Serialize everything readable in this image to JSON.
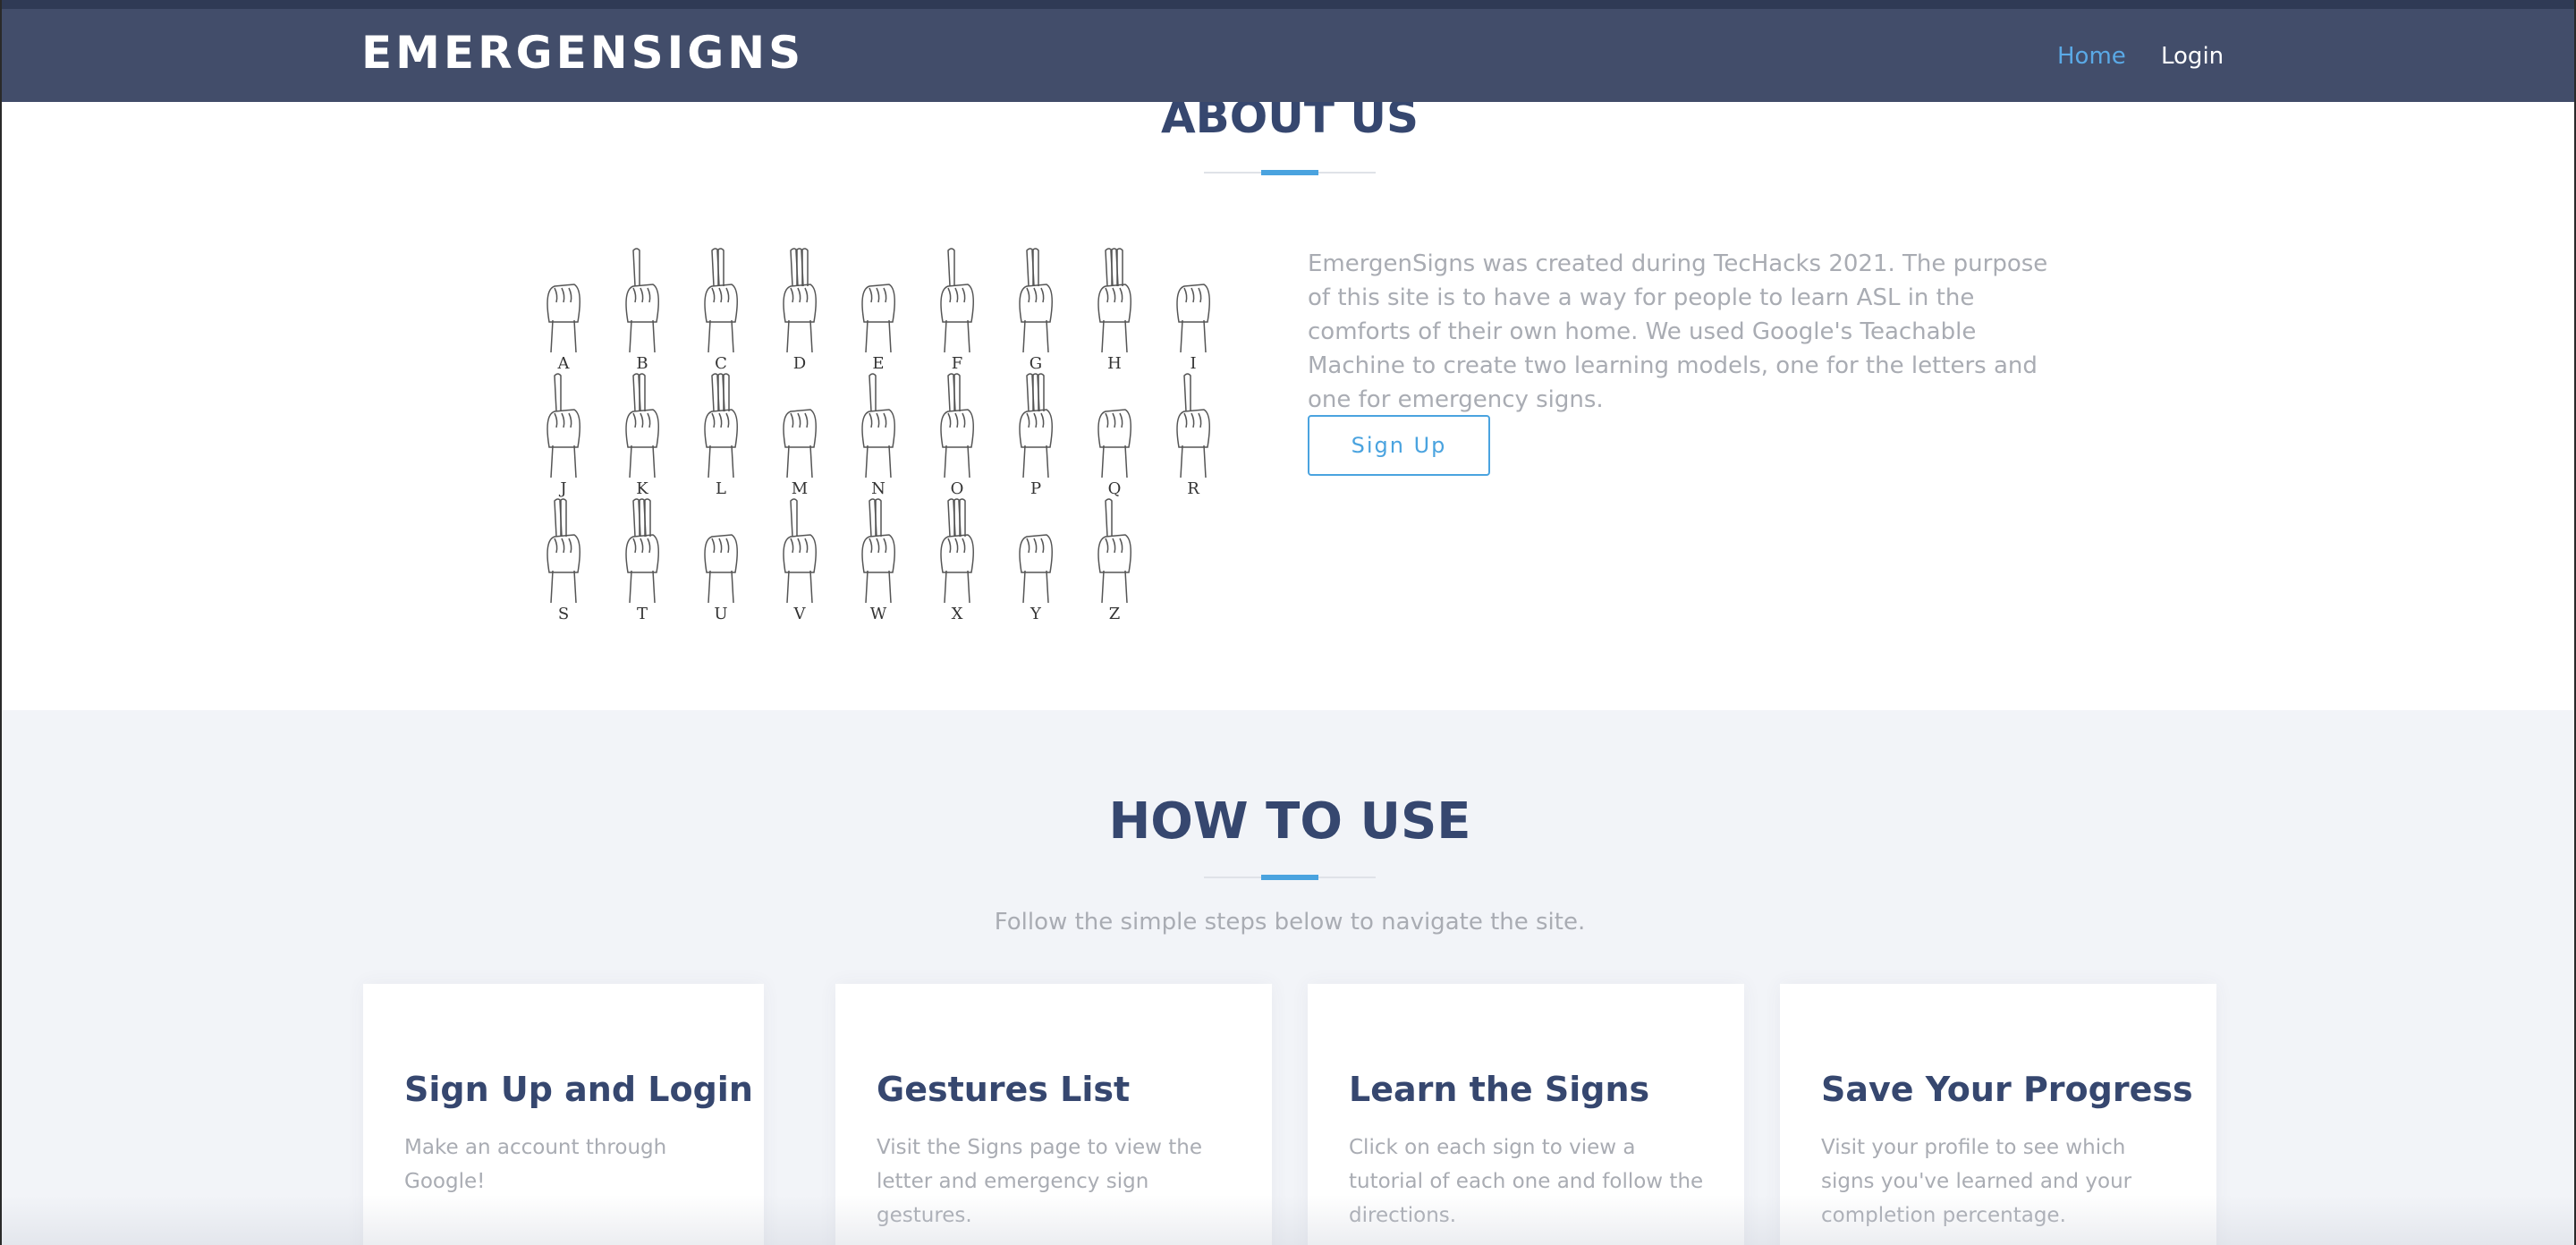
{
  "navbar": {
    "brand": "EMERGENSIGNS",
    "links": [
      {
        "label": "Home",
        "active": true
      },
      {
        "label": "Login",
        "active": false
      }
    ]
  },
  "about": {
    "title": "ABOUT US",
    "paragraph": "EmergenSigns was created during TecHacks 2021. The purpose of this site is to have a way for people to learn ASL in the comforts of their own home. We used Google's Teachable Machine to create two learning models, one for the letters and one for emergency signs.",
    "button_label": "Sign Up",
    "image": {
      "icon": "asl-alphabet-chart",
      "letters": [
        "A",
        "B",
        "C",
        "D",
        "E",
        "F",
        "G",
        "H",
        "I",
        "J",
        "K",
        "L",
        "M",
        "N",
        "O",
        "P",
        "Q",
        "R",
        "S",
        "T",
        "U",
        "V",
        "W",
        "X",
        "Y",
        "Z"
      ]
    }
  },
  "how_to_use": {
    "title": "HOW TO USE",
    "subtitle": "Follow the simple steps below to navigate the site.",
    "cards": [
      {
        "title": "Sign Up and Login",
        "text": "Make an account through Google!"
      },
      {
        "title": "Gestures List",
        "text": "Visit the Signs page to view the letter and emergency sign gestures."
      },
      {
        "title": "Learn the Signs",
        "text": "Click on each sign to view a tutorial of each one and follow the directions."
      },
      {
        "title": "Save Your Progress",
        "text": "Visit your profile to see which signs you've learned and your completion percentage."
      }
    ]
  },
  "colors": {
    "navbar": "#424d6a",
    "heading": "#36476f",
    "accent": "#4aa3df",
    "muted_text": "#a9acb3",
    "section_bg": "#f2f4f8"
  }
}
